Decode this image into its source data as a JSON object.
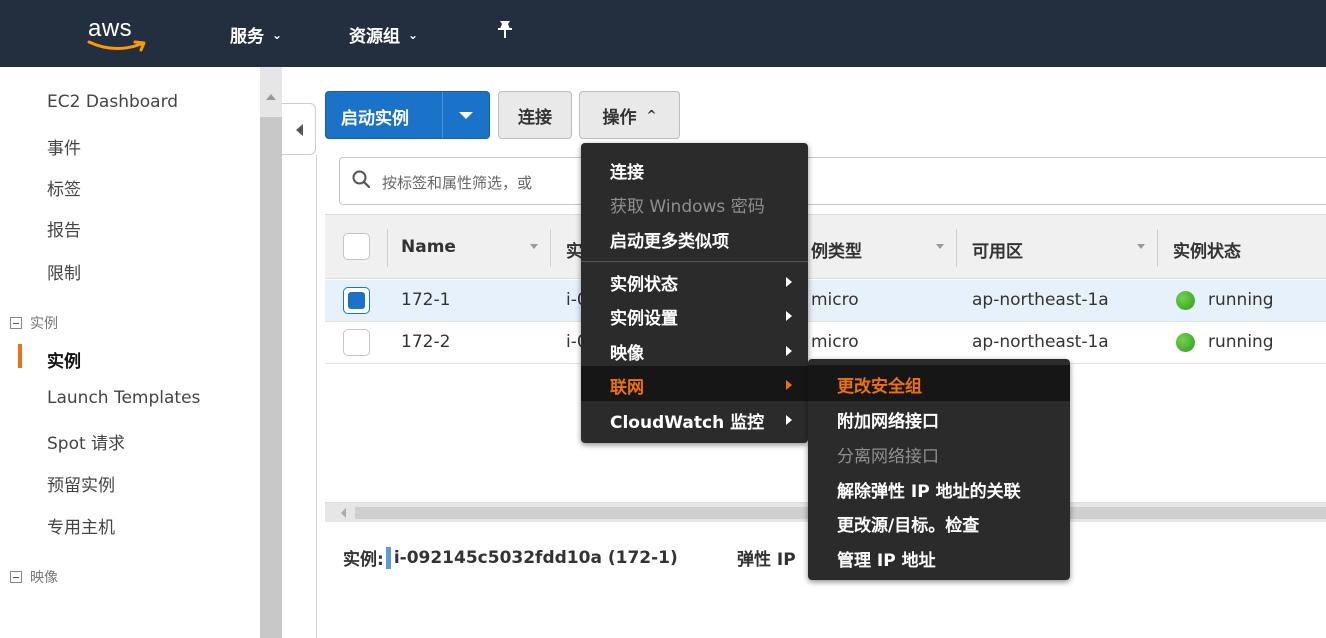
{
  "nav": {
    "logo": "aws",
    "services": "服务",
    "resource_groups": "资源组",
    "pin_icon": "pin-icon"
  },
  "sidebar": {
    "items_top": [
      "EC2 Dashboard",
      "事件",
      "标签",
      "报告",
      "限制"
    ],
    "section_instances": "实例",
    "instances_items": [
      "实例",
      "Launch Templates",
      "Spot 请求",
      "预留实例",
      "专用主机"
    ],
    "section_images": "映像",
    "active_item": "实例"
  },
  "toolbar": {
    "launch": "启动实例",
    "connect": "连接",
    "actions": "操作"
  },
  "search": {
    "placeholder": "按标签和属性筛选，或"
  },
  "table": {
    "columns": [
      "Name",
      "实",
      "例类型",
      "可用区",
      "实例状态"
    ],
    "rows": [
      {
        "name": "172-1",
        "id": "i-0",
        "type": "micro",
        "az": "ap-northeast-1a",
        "state": "running",
        "selected": true
      },
      {
        "name": "172-2",
        "id": "i-0",
        "type": "micro",
        "az": "ap-northeast-1a",
        "state": "running",
        "selected": false
      }
    ]
  },
  "details": {
    "label": "实例:",
    "instance": "i-092145c5032fdd10a (172-1)",
    "eip_label": "弹性 IP"
  },
  "actions_menu": {
    "items": [
      "连接",
      "获取 Windows 密码",
      "启动更多类似项"
    ],
    "submenus": [
      "实例状态",
      "实例设置",
      "映像",
      "联网",
      "CloudWatch 监控"
    ],
    "highlighted": "联网"
  },
  "network_submenu": {
    "items": [
      "更改安全组",
      "附加网络接口",
      "分离网络接口",
      "解除弹性 IP 地址的关联",
      "更改源/目标。检查",
      "管理 IP 地址"
    ],
    "highlighted": "更改安全组",
    "disabled": "分离网络接口"
  },
  "colors": {
    "nav_bg": "#232f3e",
    "primary": "#1a73c9",
    "accent": "#ec7211",
    "menu_bg": "#2b2b2b",
    "running": "#3fb62a"
  }
}
